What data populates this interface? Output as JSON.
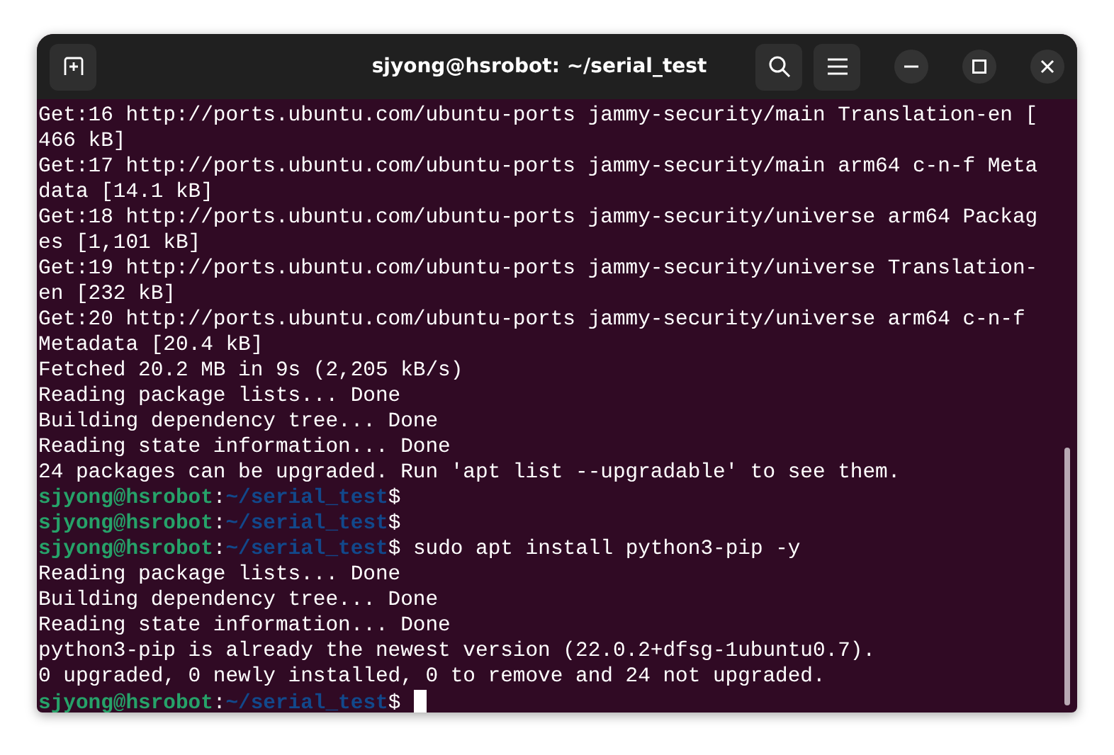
{
  "window": {
    "title": "sjyong@hsrobot: ~/serial_test"
  },
  "terminal": {
    "lines": [
      {
        "kind": "output",
        "text": "Get:16 http://ports.ubuntu.com/ubuntu-ports jammy-security/main Translation-en ["
      },
      {
        "kind": "output",
        "text": "466 kB]"
      },
      {
        "kind": "output",
        "text": "Get:17 http://ports.ubuntu.com/ubuntu-ports jammy-security/main arm64 c-n-f Meta"
      },
      {
        "kind": "output",
        "text": "data [14.1 kB]"
      },
      {
        "kind": "output",
        "text": "Get:18 http://ports.ubuntu.com/ubuntu-ports jammy-security/universe arm64 Packag"
      },
      {
        "kind": "output",
        "text": "es [1,101 kB]"
      },
      {
        "kind": "output",
        "text": "Get:19 http://ports.ubuntu.com/ubuntu-ports jammy-security/universe Translation-"
      },
      {
        "kind": "output",
        "text": "en [232 kB]"
      },
      {
        "kind": "output",
        "text": "Get:20 http://ports.ubuntu.com/ubuntu-ports jammy-security/universe arm64 c-n-f"
      },
      {
        "kind": "output",
        "text": "Metadata [20.4 kB]"
      },
      {
        "kind": "output",
        "text": "Fetched 20.2 MB in 9s (2,205 kB/s)"
      },
      {
        "kind": "output",
        "text": "Reading package lists... Done"
      },
      {
        "kind": "output",
        "text": "Building dependency tree... Done"
      },
      {
        "kind": "output",
        "text": "Reading state information... Done"
      },
      {
        "kind": "output",
        "text": "24 packages can be upgraded. Run 'apt list --upgradable' to see them."
      },
      {
        "kind": "prompt",
        "user": "sjyong@hsrobot",
        "separator": ":",
        "path": "~/serial_test",
        "sigil": "$",
        "cursor": false
      },
      {
        "kind": "prompt",
        "user": "sjyong@hsrobot",
        "separator": ":",
        "path": "~/serial_test",
        "sigil": "$",
        "cursor": false
      },
      {
        "kind": "prompt",
        "user": "sjyong@hsrobot",
        "separator": ":",
        "path": "~/serial_test",
        "sigil": "$",
        "command": "sudo apt install python3-pip -y",
        "cursor": false
      },
      {
        "kind": "output",
        "text": "Reading package lists... Done"
      },
      {
        "kind": "output",
        "text": "Building dependency tree... Done"
      },
      {
        "kind": "output",
        "text": "Reading state information... Done"
      },
      {
        "kind": "output",
        "text": "python3-pip is already the newest version (22.0.2+dfsg-1ubuntu0.7)."
      },
      {
        "kind": "output",
        "text": "0 upgraded, 0 newly installed, 0 to remove and 24 not upgraded."
      },
      {
        "kind": "prompt",
        "user": "sjyong@hsrobot",
        "separator": ":",
        "path": "~/serial_test",
        "sigil": "$",
        "cursor": true
      }
    ]
  }
}
